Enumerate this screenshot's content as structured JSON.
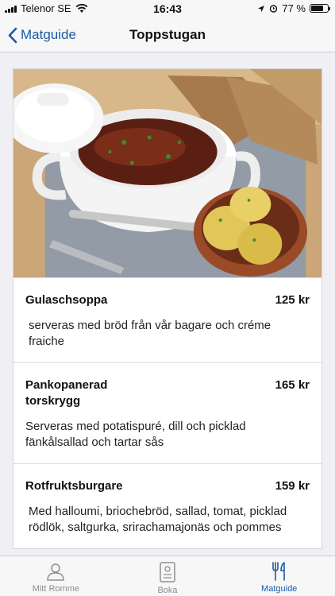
{
  "status": {
    "carrier": "Telenor SE",
    "time": "16:43",
    "battery": "77 %",
    "battery_level": 0.77
  },
  "nav": {
    "back_label": "Matguide",
    "title": "Toppstugan"
  },
  "menu": [
    {
      "name": "Gulaschsoppa",
      "price": "125 kr",
      "description": "serveras med bröd från vår bagare och créme fraiche"
    },
    {
      "name": "Pankopanerad torskrygg",
      "price": "165 kr",
      "description": "Serveras med potatispuré, dill och picklad fänkålsallad och tartar sås"
    },
    {
      "name": "Rotfruktsburgare",
      "price": "159 kr",
      "description": "Med halloumi, briochebröd, sallad, tomat, picklad rödlök, saltgurka, srirachamajonäs och pommes"
    }
  ],
  "tabs": [
    {
      "label": "Mitt Romme",
      "icon": "person-icon",
      "active": false
    },
    {
      "label": "Boka",
      "icon": "booking-icon",
      "active": false
    },
    {
      "label": "Matguide",
      "icon": "cutlery-icon",
      "active": true
    }
  ],
  "colors": {
    "accent": "#1c5aa6",
    "inactive": "#8e8e93"
  }
}
